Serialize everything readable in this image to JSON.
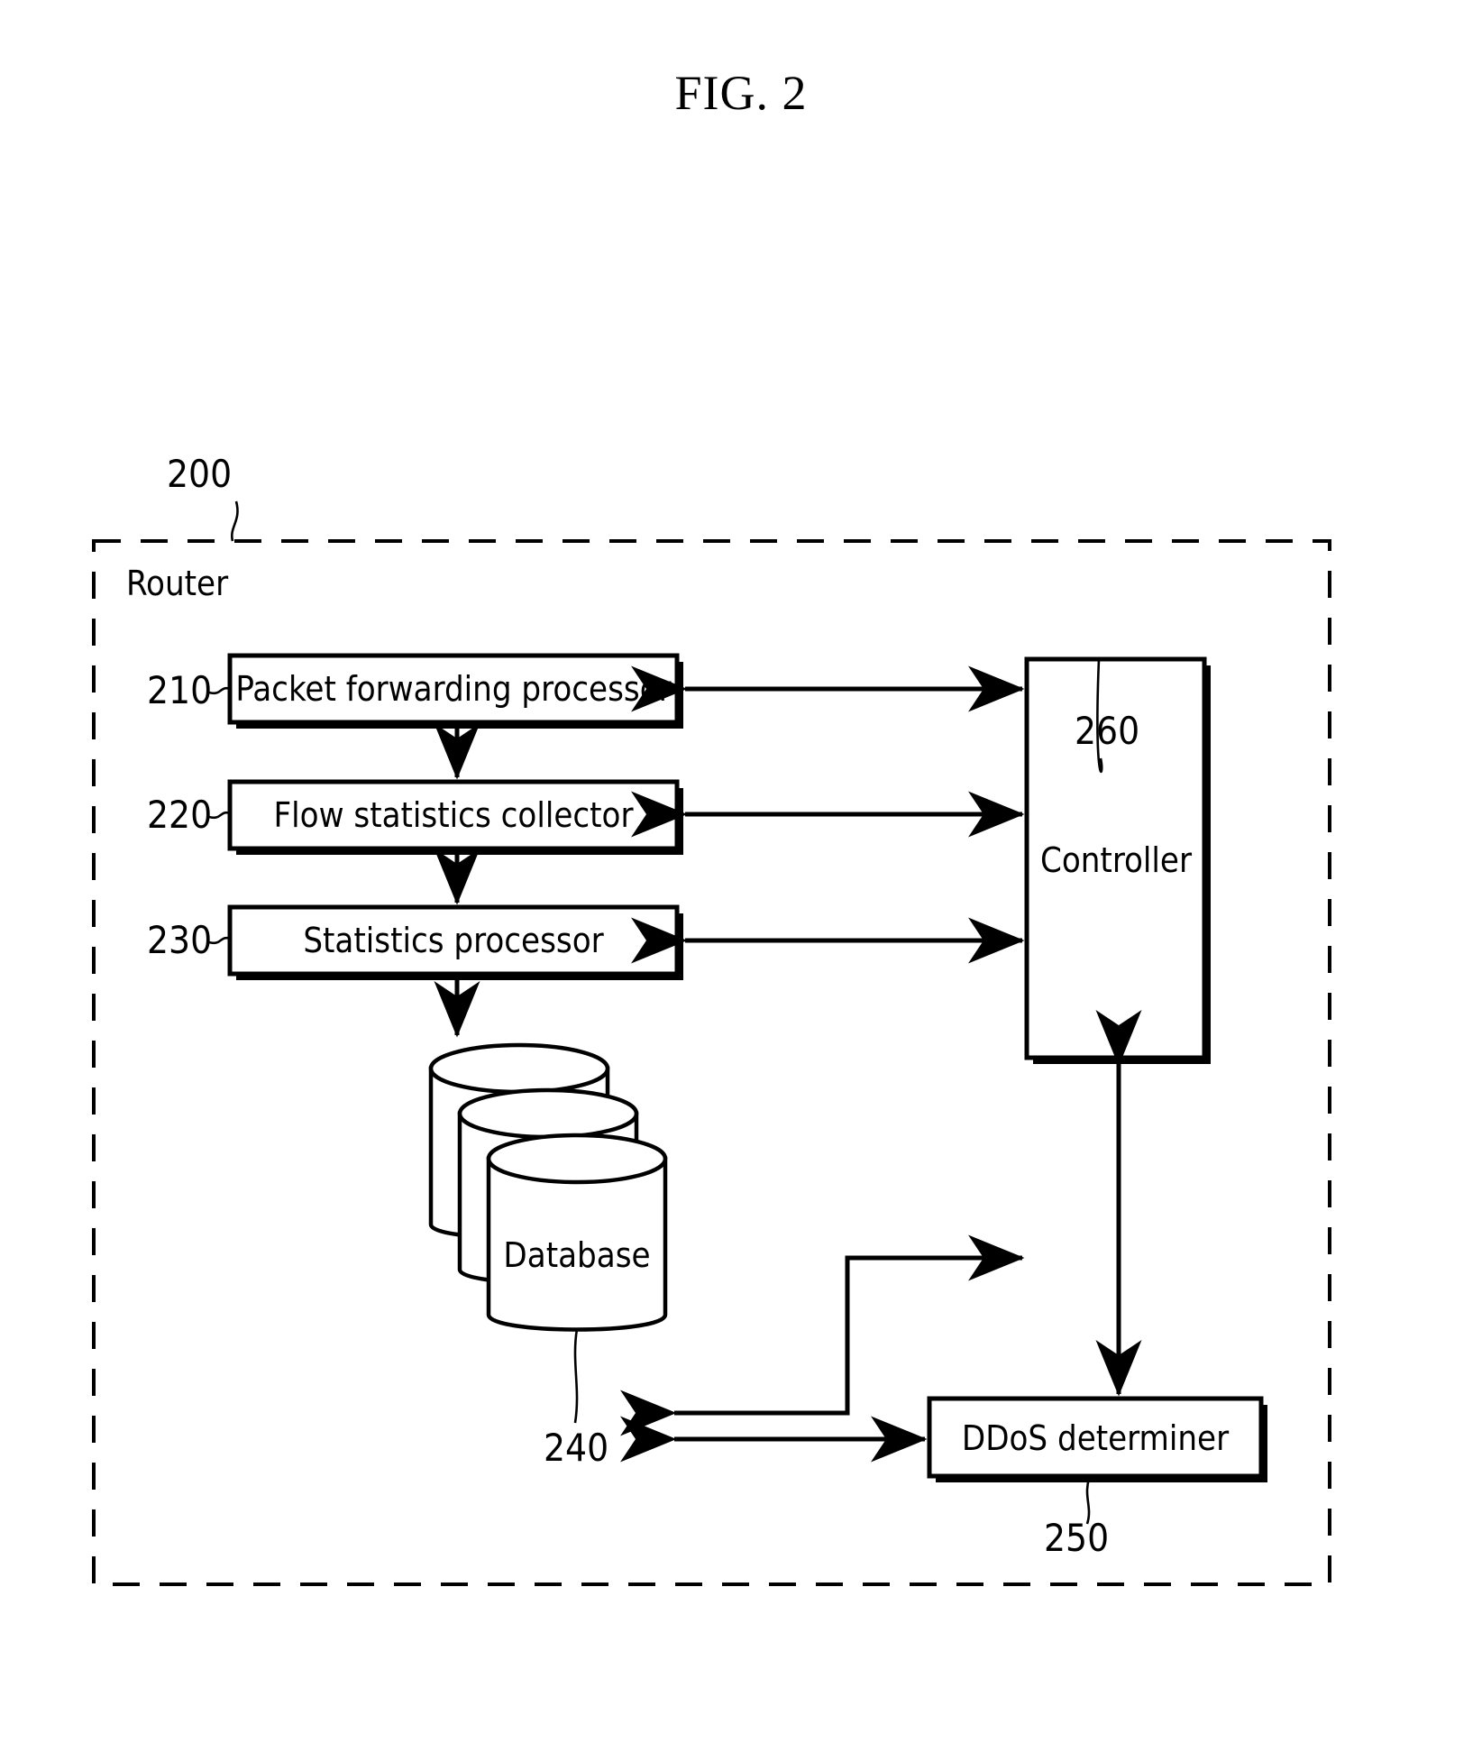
{
  "figure": {
    "title": "FIG. 2"
  },
  "diagram": {
    "container": {
      "label": "Router",
      "ref": "200"
    },
    "blocks": [
      {
        "id": "packet-forwarding-processor",
        "label": "Packet forwarding processor",
        "ref": "210"
      },
      {
        "id": "flow-statistics-collector",
        "label": "Flow statistics collector",
        "ref": "220"
      },
      {
        "id": "statistics-processor",
        "label": "Statistics processor",
        "ref": "230"
      },
      {
        "id": "database",
        "label": "Database",
        "ref": "240"
      },
      {
        "id": "ddos-determiner",
        "label": "DDoS determiner",
        "ref": "250"
      },
      {
        "id": "controller",
        "label": "Controller",
        "ref": "260"
      }
    ],
    "connections": [
      {
        "from": "packet-forwarding-processor",
        "to": "flow-statistics-collector",
        "type": "arrow-down"
      },
      {
        "from": "flow-statistics-collector",
        "to": "statistics-processor",
        "type": "arrow-down"
      },
      {
        "from": "statistics-processor",
        "to": "database",
        "type": "arrow-down"
      },
      {
        "from": "packet-forwarding-processor",
        "to": "controller",
        "type": "bidirectional"
      },
      {
        "from": "flow-statistics-collector",
        "to": "controller",
        "type": "bidirectional"
      },
      {
        "from": "statistics-processor",
        "to": "controller",
        "type": "bidirectional"
      },
      {
        "from": "database",
        "to": "controller",
        "type": "elbow-bidirectional"
      },
      {
        "from": "database",
        "to": "ddos-determiner",
        "type": "bidirectional"
      },
      {
        "from": "controller",
        "to": "ddos-determiner",
        "type": "bidirectional-vertical"
      }
    ]
  },
  "colors": {
    "ink": "#000000",
    "paper": "#ffffff"
  }
}
